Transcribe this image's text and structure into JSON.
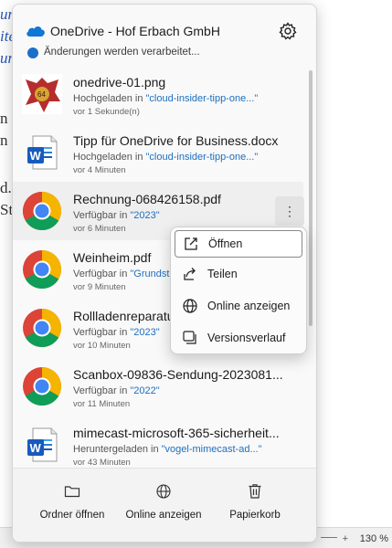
{
  "background": {
    "fragments": [
      "un",
      "ite",
      "un",
      "n h",
      "n",
      "d.",
      "Sta"
    ],
    "zoom_plus": "+",
    "zoom": "130 %"
  },
  "header": {
    "title": "OneDrive - Hof Erbach GmbH",
    "sync_status": "Änderungen werden verarbeitet..."
  },
  "files": [
    {
      "name": "onedrive-01.png",
      "action": "Hochgeladen in ",
      "location": "\"cloud-insider-tipp-one...\"",
      "time": "vor 1 Sekunde(n)",
      "icon": "image-thumbnail-icon"
    },
    {
      "name": "Tipp für OneDrive for Business.docx",
      "action": "Hochgeladen in ",
      "location": "\"cloud-insider-tipp-one...\"",
      "time": "vor 4 Minuten",
      "icon": "word-doc-icon"
    },
    {
      "name": "Rechnung-068426158.pdf",
      "action": "Verfügbar in ",
      "location": "\"2023\"",
      "time": "vor 6 Minuten",
      "icon": "chrome-icon"
    },
    {
      "name": "Weinheim.pdf",
      "action": "Verfügbar in ",
      "location": "\"Grundst",
      "time": "vor 9 Minuten",
      "icon": "chrome-icon"
    },
    {
      "name": "Rollladenreparatur.",
      "action": "Verfügbar in ",
      "location": "\"2023\"",
      "time": "vor 10 Minuten",
      "icon": "chrome-icon"
    },
    {
      "name": "Scanbox-09836-Sendung-2023081...",
      "action": "Verfügbar in ",
      "location": "\"2022\"",
      "time": "vor 11 Minuten",
      "icon": "chrome-icon"
    },
    {
      "name": "mimecast-microsoft-365-sicherheit...",
      "action": "Heruntergeladen in ",
      "location": "\"vogel-mimecast-ad...\"",
      "time": "vor 43 Minuten",
      "icon": "word-doc-icon"
    }
  ],
  "more_button": "⋮",
  "context_menu": [
    {
      "label": "Öffnen",
      "icon": "open-external-icon"
    },
    {
      "label": "Teilen",
      "icon": "share-icon"
    },
    {
      "label": "Online anzeigen",
      "icon": "globe-icon"
    },
    {
      "label": "Versionsverlauf",
      "icon": "version-history-icon"
    }
  ],
  "footer": [
    {
      "label": "Ordner öffnen",
      "icon": "folder-icon"
    },
    {
      "label": "Online anzeigen",
      "icon": "globe-icon"
    },
    {
      "label": "Papierkorb",
      "icon": "trash-icon"
    }
  ],
  "colors": {
    "accent": "#1e6fbf",
    "onedrive_blue": "#0f78d4",
    "word_blue": "#185abd"
  }
}
